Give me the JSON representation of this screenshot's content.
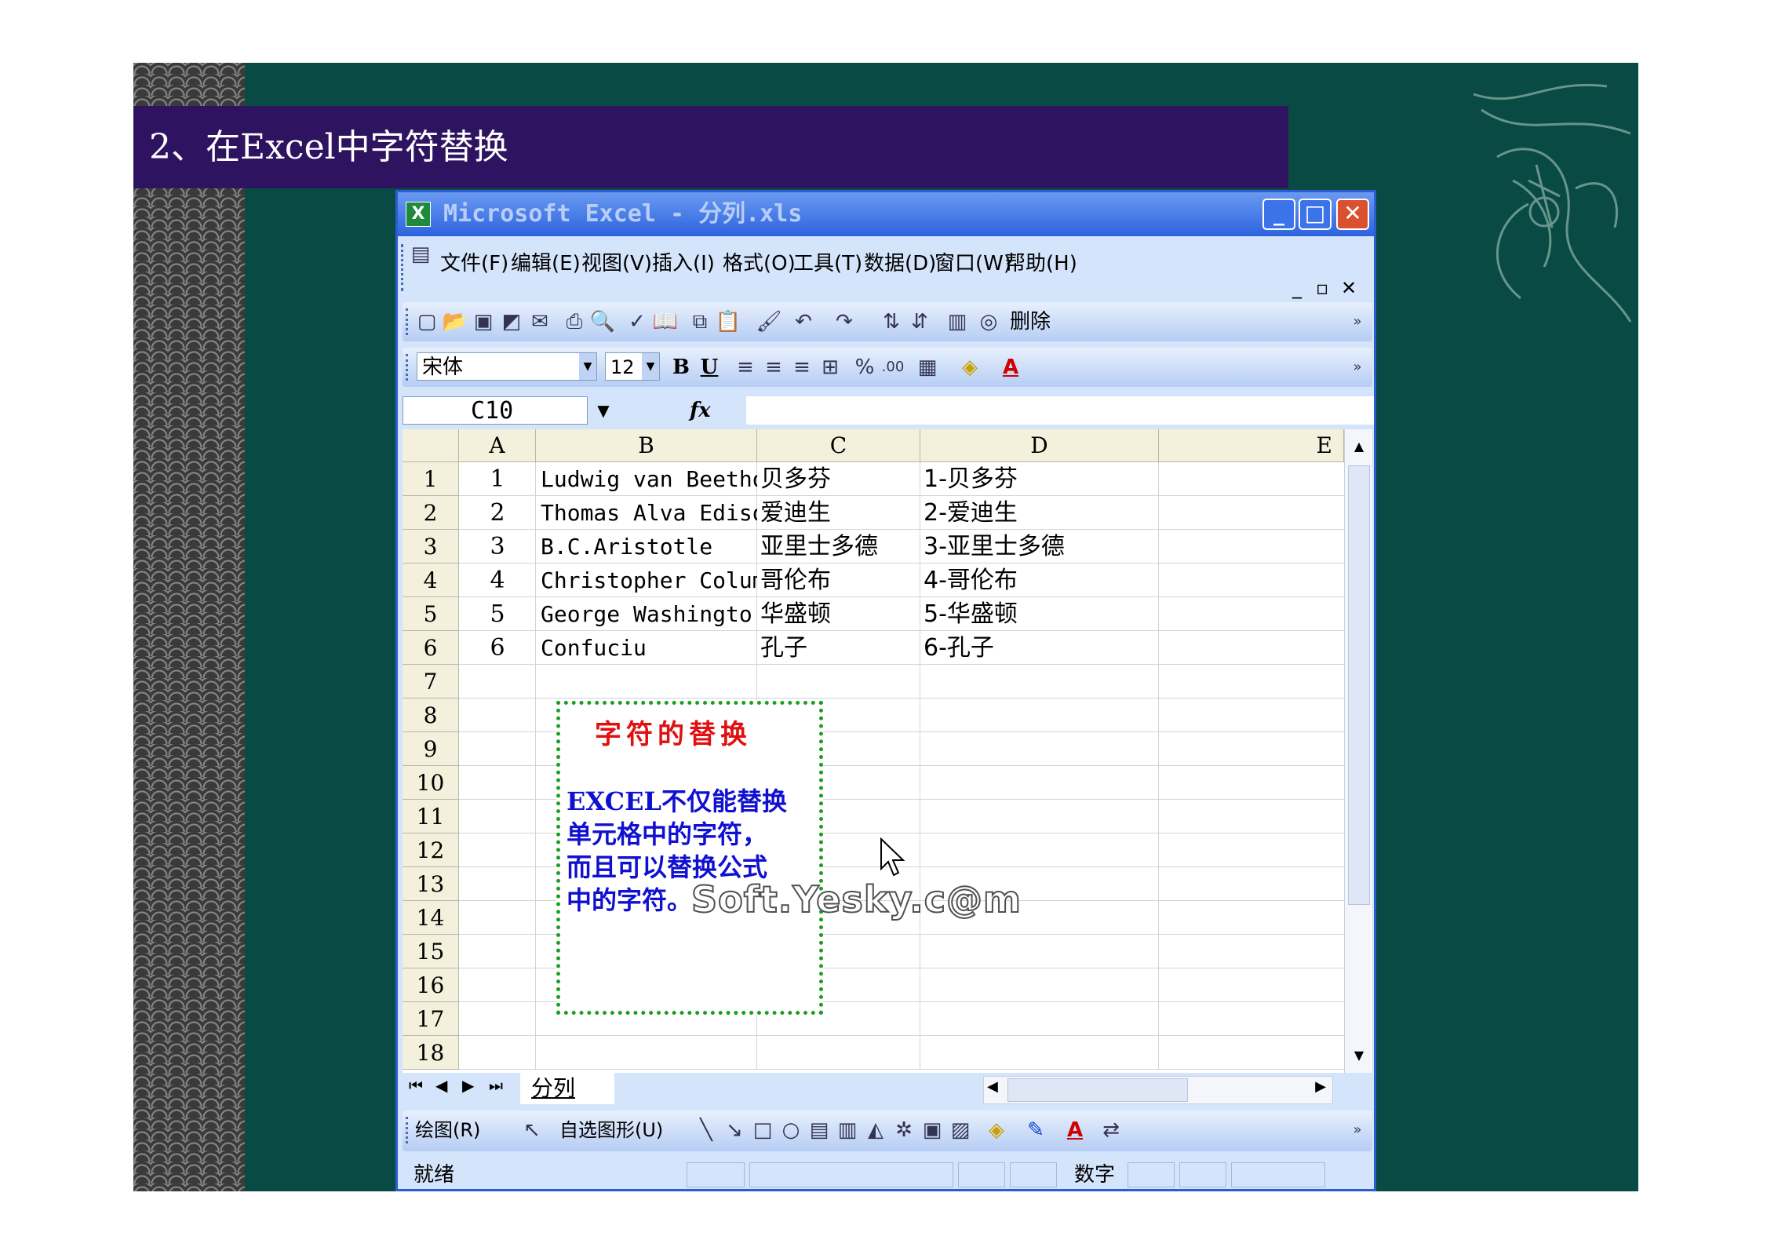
{
  "slide": {
    "title": "2、在Excel中字符替换"
  },
  "window": {
    "title": "Microsoft Excel - 分列.xls"
  },
  "menu": [
    {
      "label": "文件(F)"
    },
    {
      "label": "编辑(E)"
    },
    {
      "label": "视图(V)"
    },
    {
      "label": "插入(I)"
    },
    {
      "label": "格式(O)"
    },
    {
      "label": "工具(T)"
    },
    {
      "label": "数据(D)"
    },
    {
      "label": "窗口(W)"
    },
    {
      "label": "帮助(H)"
    }
  ],
  "toolbar": {
    "delete_label": "删除",
    "font": "宋体",
    "font_size": "12"
  },
  "formula": {
    "name_box": "C10",
    "fx": "fx"
  },
  "columns": [
    "A",
    "B",
    "C",
    "D",
    "E"
  ],
  "rows": [
    {
      "a": "1",
      "b": "Ludwig van Beethoven",
      "c": "贝多芬",
      "d": "1-贝多芬"
    },
    {
      "a": "2",
      "b": "Thomas Alva Edison",
      "c": "爱迪生",
      "d": "2-爱迪生"
    },
    {
      "a": "3",
      "b": "B.C.Aristotle",
      "c": "亚里士多德",
      "d": "3-亚里士多德"
    },
    {
      "a": "4",
      "b": "Christopher Columbu",
      "c": "哥伦布",
      "d": "4-哥伦布"
    },
    {
      "a": "5",
      "b": "George Washingto",
      "c": "华盛顿",
      "d": "5-华盛顿"
    },
    {
      "a": "6",
      "b": "Confuciu",
      "c": "孔子",
      "d": "6-孔子"
    }
  ],
  "row_numbers": [
    "1",
    "2",
    "3",
    "4",
    "5",
    "6",
    "7",
    "8",
    "9",
    "10",
    "11",
    "12",
    "13",
    "14",
    "15",
    "16",
    "17",
    "18"
  ],
  "textbox": {
    "title": "字符的替换",
    "body": [
      "EXCEL不仅能替换",
      "单元格中的字符，",
      "而且可以替换公式",
      "中的字符。"
    ]
  },
  "watermark": "Soft.Yesky.c@m",
  "sheet_tab": "分列",
  "drawing": {
    "draw_label": "绘图(R)",
    "autoshape_label": "自选图形(U)"
  },
  "status": {
    "ready": "就绪",
    "num": "数字"
  },
  "colors": {
    "slide_bg": "#0a4a44",
    "title_bar": "#2e1360",
    "textbox_border": "#18a020",
    "textbox_title": "#e01010",
    "textbox_body": "#1010d0"
  }
}
